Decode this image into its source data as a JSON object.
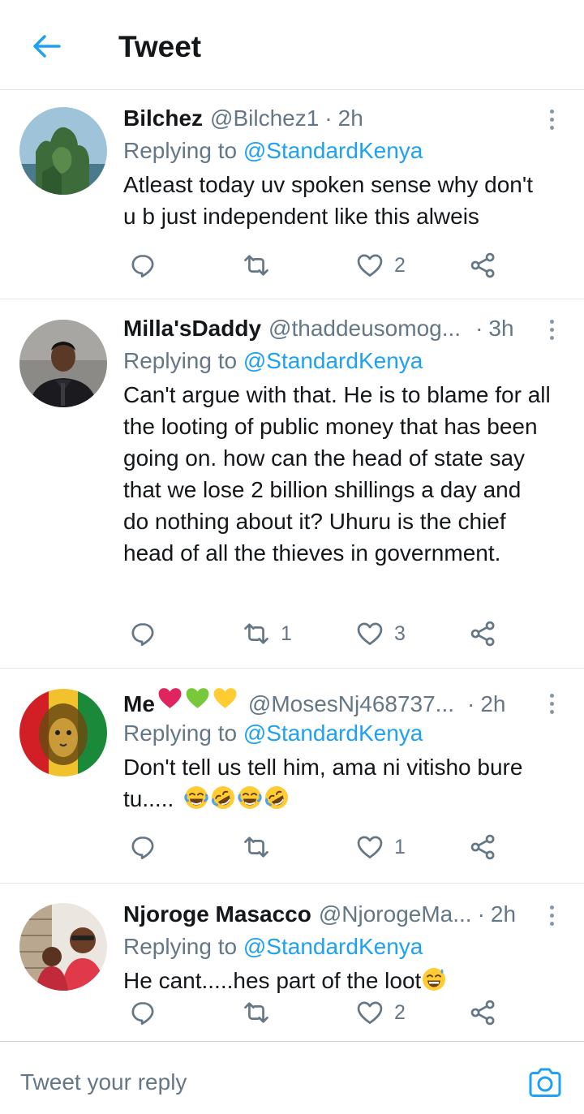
{
  "header": {
    "title": "Tweet"
  },
  "tweets": [
    {
      "name": "Bilchez",
      "handle": "@Bilchez1",
      "time": "2h",
      "replying_label": "Replying to",
      "replying_to": "@StandardKenya",
      "text": "Atleast today uv spoken sense why don't u b just independent like this alweis",
      "retweets": "",
      "likes": "2"
    },
    {
      "name": "Milla'sDaddy",
      "handle": "@thaddeusomog...",
      "time": "3h",
      "replying_label": "Replying to",
      "replying_to": "@StandardKenya",
      "text": "Can't argue with that. He is to blame for all the looting of public money that has been going on. how can the head of state say that we lose 2 billion shillings a day and do nothing about it? Uhuru is the chief head of all the thieves in government.",
      "retweets": "1",
      "likes": "3"
    },
    {
      "name": "Me",
      "handle": "@MosesNj468737...",
      "time": "2h",
      "replying_label": "Replying to",
      "replying_to": "@StandardKenya",
      "text": "Don't tell us tell him, ama ni vitisho bure tu.....",
      "retweets": "",
      "likes": "1"
    },
    {
      "name": "Njoroge Masacco",
      "handle": "@NjorogeMa...",
      "time": "2h",
      "replying_label": "Replying to",
      "replying_to": "@StandardKenya",
      "text": "He cant.....hes part of the loot",
      "retweets": "",
      "likes": "2"
    }
  ],
  "compose": {
    "placeholder": "Tweet your reply"
  },
  "icons": {
    "back": "arrow-left-icon",
    "more": "more-vertical-icon",
    "reply": "reply-bubble-icon",
    "retweet": "retweet-icon",
    "like": "heart-icon",
    "share": "share-icon",
    "camera": "camera-icon"
  },
  "colors": {
    "accent": "#1da1f2",
    "text": "#14171a",
    "secondary": "#657786",
    "divider": "#e1e8ed"
  }
}
